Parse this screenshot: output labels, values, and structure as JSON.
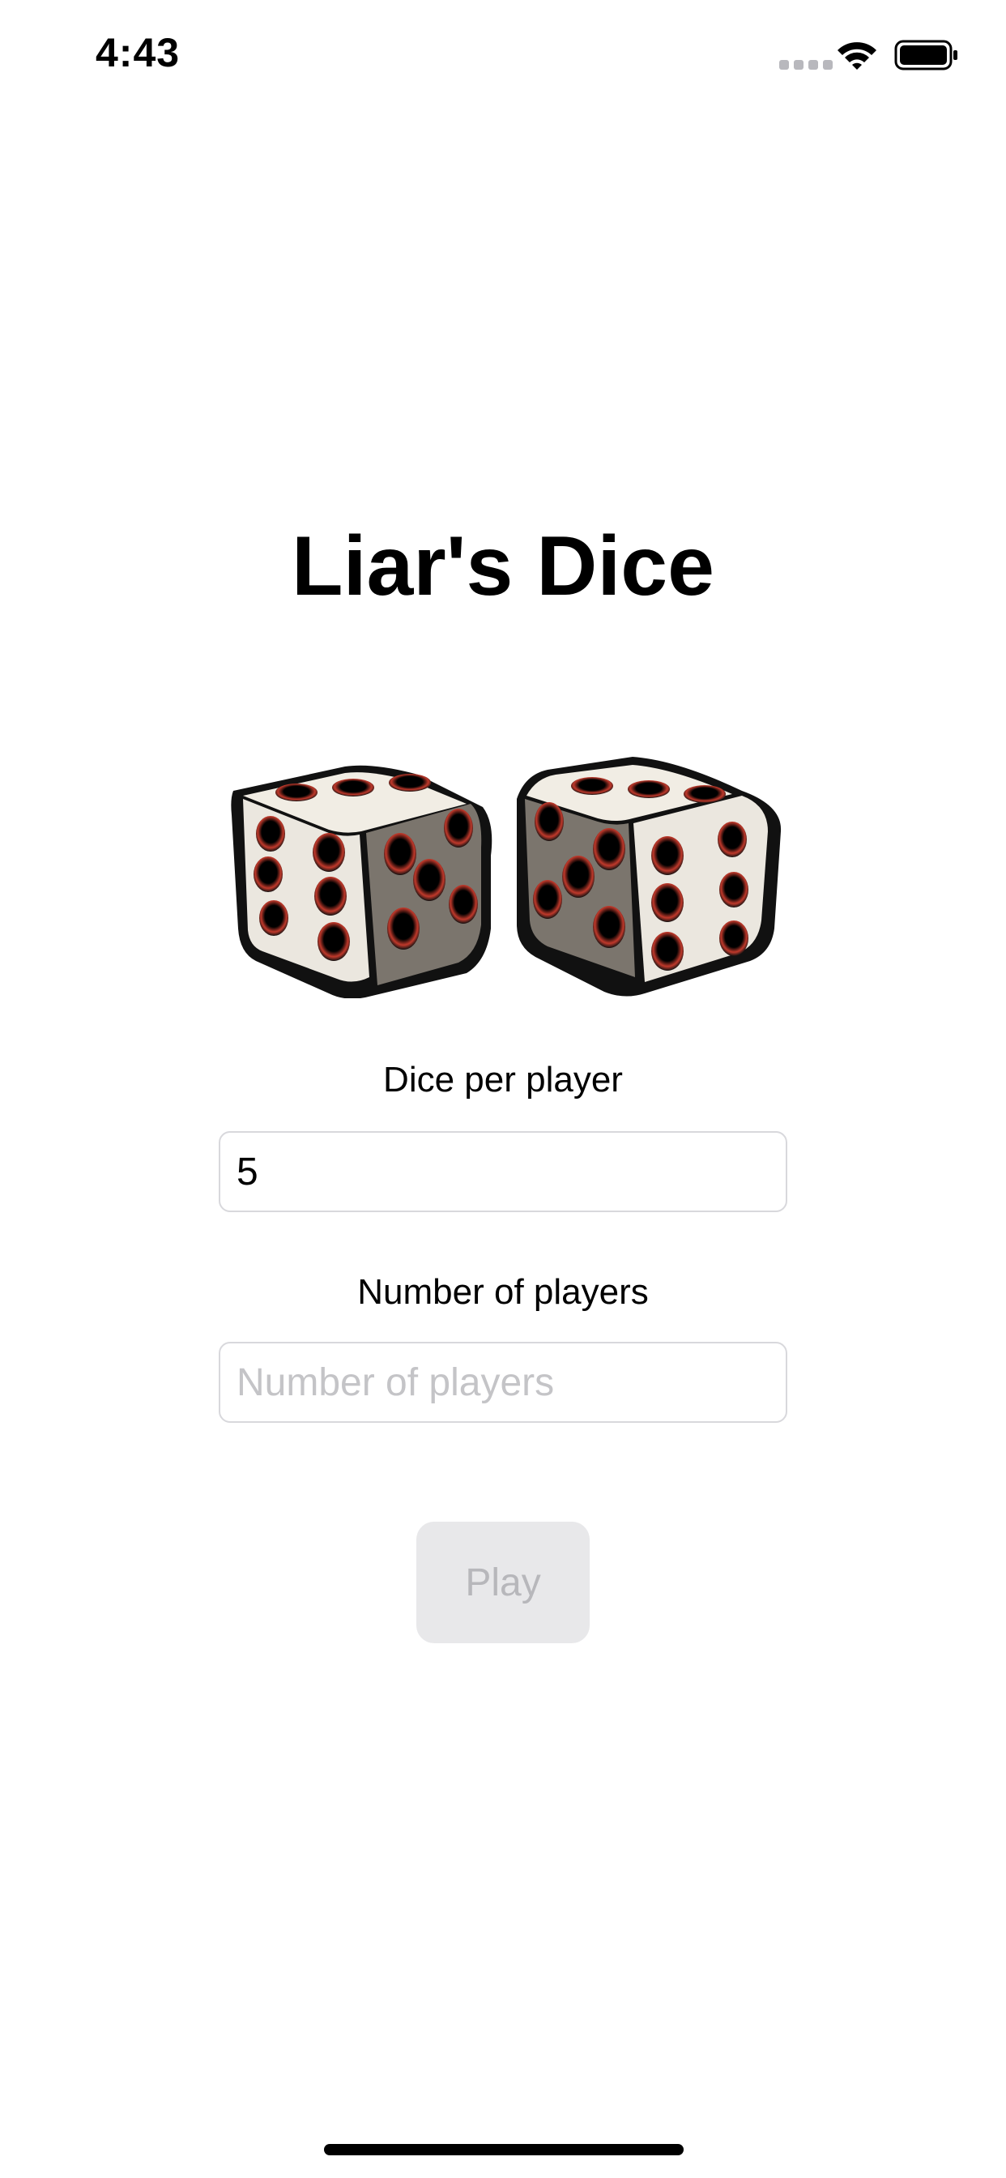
{
  "status_bar": {
    "time": "4:43",
    "icons": [
      "signal-icon",
      "wifi-icon",
      "battery-icon"
    ]
  },
  "screen": {
    "title": "Liar's Dice",
    "image": "dice-illustration"
  },
  "form": {
    "dice_per_player": {
      "label": "Dice per player",
      "value": "5",
      "placeholder": ""
    },
    "number_of_players": {
      "label": "Number of players",
      "value": "",
      "placeholder": "Number of players"
    },
    "play_label": "Play",
    "play_enabled": false
  },
  "colors": {
    "background": "#ffffff",
    "disabled_button_bg": "#e8e8ea",
    "disabled_button_text": "#b7b7bb",
    "field_border": "#d8d8dc",
    "pip_accent": "#c0392b"
  }
}
